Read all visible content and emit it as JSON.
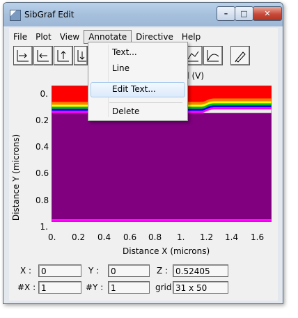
{
  "window": {
    "title": "SibGraf Edit",
    "controls": {
      "minimize": "–",
      "maximize": "□",
      "close": "✕"
    }
  },
  "menubar": {
    "items": [
      "File",
      "Plot",
      "View",
      "Annotate",
      "Directive",
      "Help"
    ]
  },
  "toolbar": {
    "icons": [
      "zoom-right-icon",
      "zoom-left-icon",
      "zoom-up-icon",
      "zoom-down-icon",
      "plot-tool-icon",
      "curve-tool-icon",
      "pen-tool-icon"
    ]
  },
  "annotate_menu": {
    "items": [
      "Text...",
      "Line",
      "Edit Text...",
      "Delete"
    ],
    "highlighted": "Edit Text..."
  },
  "plot": {
    "title_fragment": "al (V)",
    "ylabel": "Distance Y (microns)",
    "xlabel": "Distance X (microns)",
    "yticks": [
      "0.",
      "0.2",
      "0.4",
      "0.6",
      "0.8",
      "1."
    ],
    "xticks": [
      "0.",
      "0.2",
      "0.4",
      "0.6",
      "0.8",
      "1.",
      "1.2",
      "1.4",
      "1.6"
    ]
  },
  "chart_data": {
    "type": "heatmap",
    "xlabel": "Distance X (microns)",
    "ylabel": "Distance Y (microns)",
    "xlim": [
      0,
      1.7
    ],
    "ylim": [
      1.0,
      0
    ],
    "bands": [
      {
        "color": "#ff0000",
        "y_from": 0.0,
        "y_to": 0.12
      },
      {
        "color": "#ff8000",
        "y_from": 0.12,
        "y_to": 0.14
      },
      {
        "color": "#ffff00",
        "y_from": 0.14,
        "y_to": 0.155
      },
      {
        "color": "#00c000",
        "y_from": 0.155,
        "y_to": 0.17
      },
      {
        "color": "#0000ff",
        "y_from": 0.17,
        "y_to": 0.185
      },
      {
        "color": "#ff00ff",
        "y_from": 0.185,
        "y_to": 0.2
      },
      {
        "color": "#800080",
        "y_from": 0.2,
        "y_to": 0.98
      },
      {
        "color": "#ff00ff",
        "y_from": 0.98,
        "y_to": 1.0
      }
    ],
    "step_x": 1.2
  },
  "status": {
    "x_label": "X :",
    "x_value": "0",
    "y_label": "Y :",
    "y_value": "0",
    "z_label": "Z :",
    "z_value": "0.52405",
    "nx_label": "#X :",
    "nx_value": "1",
    "ny_label": "#Y :",
    "ny_value": "1",
    "grid_label": "grid",
    "grid_value": "31 x 50"
  }
}
